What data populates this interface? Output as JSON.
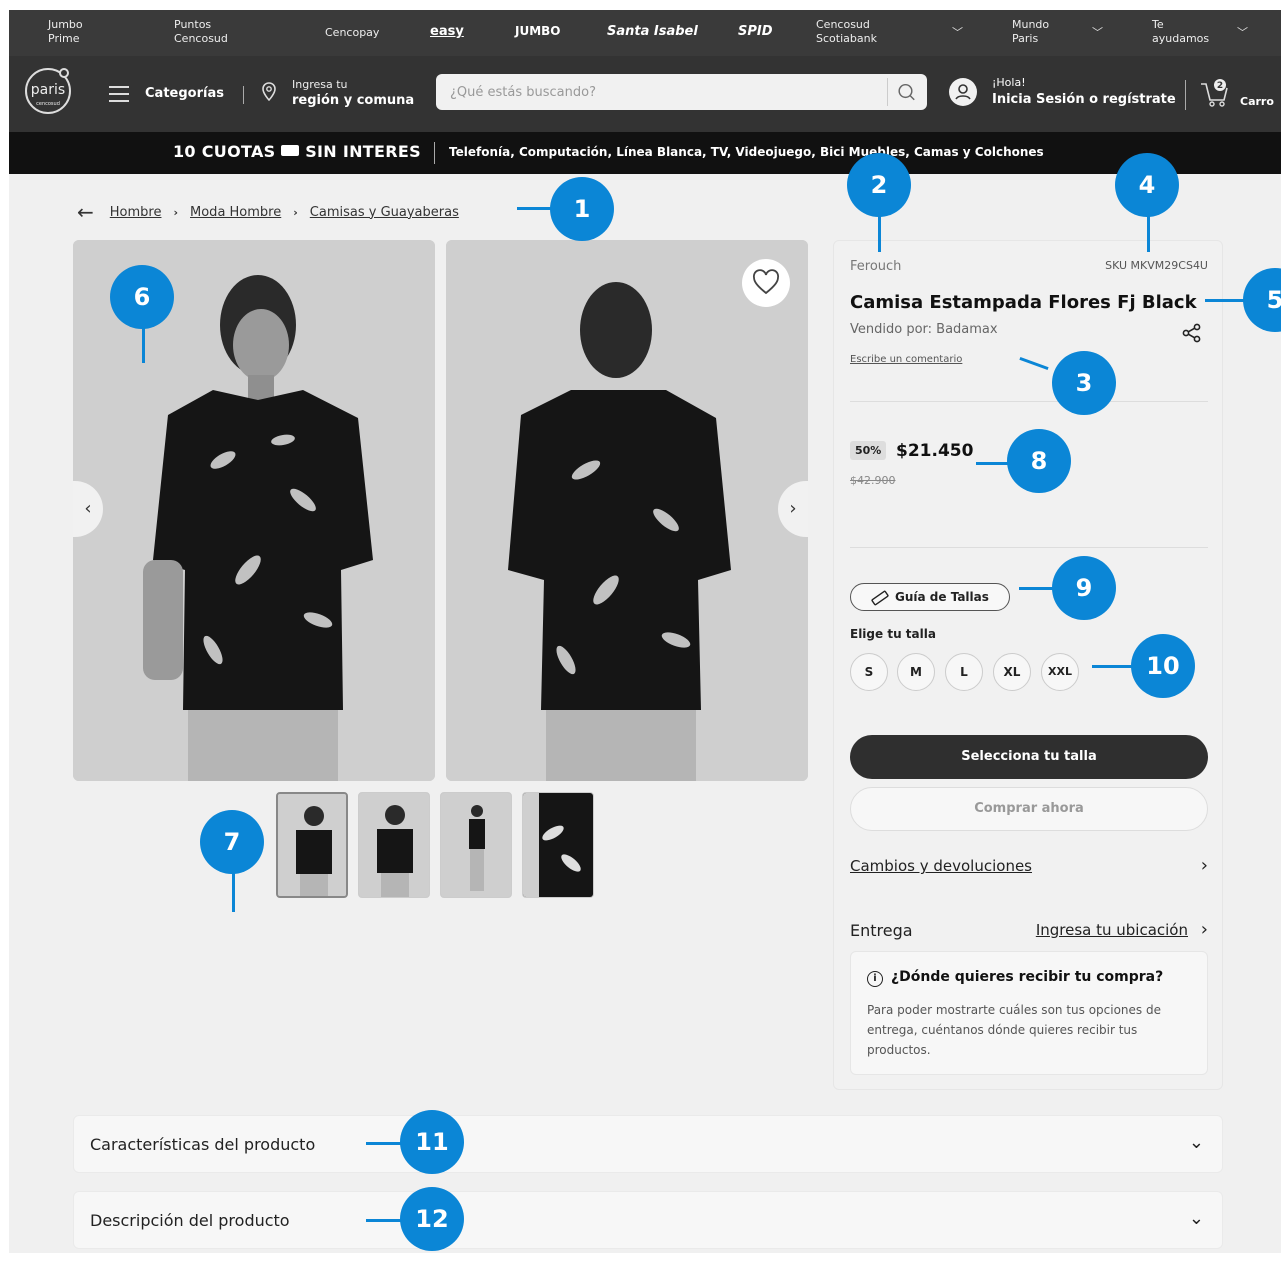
{
  "top_bar": {
    "items": [
      "Jumbo Prime",
      "Puntos Cencosud",
      "Cencopay",
      "easy",
      "JUMBO",
      "Santa Isabel",
      "SPID",
      "Cencosud Scotiabank",
      "Mundo Paris",
      "Te ayudamos"
    ]
  },
  "header": {
    "logo_text": "paris",
    "logo_sub": "cencosud",
    "categories_label": "Categorías",
    "region_line1": "Ingresa tu",
    "region_line2": "región y comuna",
    "search_placeholder": "¿Qué estás buscando?",
    "greeting": "¡Hola!",
    "login_label": "Inicia Sesión o regístrate",
    "cart_count": "2",
    "cart_label": "Carro"
  },
  "banner": {
    "promo": "10 CUOTAS",
    "promo2": "SIN INTERES",
    "categories": "Telefonía, Computación, Línea Blanca, TV, Videojuego, Bici     Muebles, Camas y Colchones"
  },
  "breadcrumb": [
    "Hombre",
    "Moda Hombre",
    "Camisas y Guayaberas"
  ],
  "product": {
    "brand": "Ferouch",
    "sku": "SKU MKVM29CS4U",
    "title": "Camisa Estampada Flores Fj Black",
    "seller": "Vendido por: Badamax",
    "review_link": "Escribe un comentario",
    "discount": "50%",
    "price": "$21.450",
    "old_price": "$42.900",
    "size_guide": "Guía de Tallas",
    "size_label": "Elige tu talla",
    "sizes": [
      "S",
      "M",
      "L",
      "XL",
      "XXL"
    ],
    "select_size_button": "Selecciona tu talla",
    "buy_now_button": "Comprar ahora",
    "returns_link": "Cambios y devoluciones",
    "delivery_label": "Entrega",
    "location_link": "Ingresa tu ubicación",
    "info_title": "¿Dónde quieres recibir tu compra?",
    "info_body": "Para poder mostrarte cuáles son tus opciones de entrega, cuéntanos dónde quieres recibir tus productos."
  },
  "accordions": [
    "Características del producto",
    "Descripción del producto"
  ],
  "callouts": [
    "1",
    "2",
    "3",
    "4",
    "5",
    "6",
    "7",
    "8",
    "9",
    "10",
    "11",
    "12"
  ],
  "colors": {
    "callout": "#0b86d6",
    "header": "#333333",
    "banner": "#111111"
  }
}
